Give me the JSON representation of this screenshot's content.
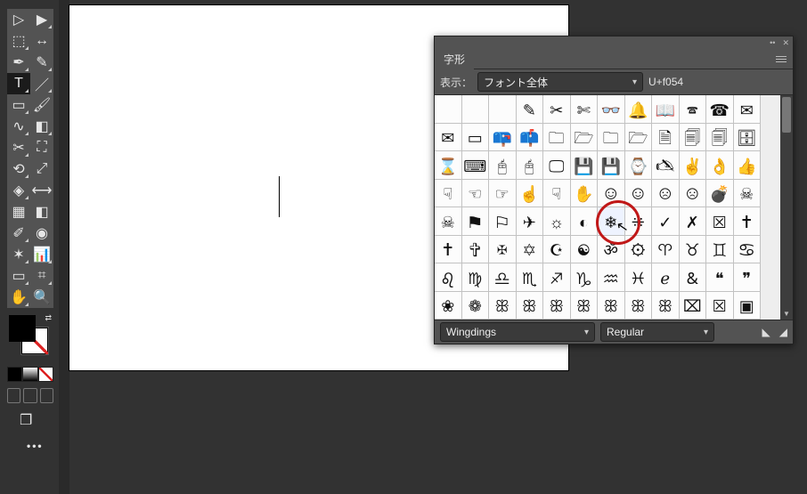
{
  "toolbox": {
    "tools": [
      {
        "name": "selection-tool",
        "glyph": "▷",
        "tri": false
      },
      {
        "name": "direct-selection-tool",
        "glyph": "▶",
        "tri": true
      },
      {
        "name": "page-tool",
        "glyph": "⬚",
        "tri": true
      },
      {
        "name": "gap-tool",
        "glyph": "↔",
        "tri": false
      },
      {
        "name": "pen-tool",
        "glyph": "✒",
        "tri": true
      },
      {
        "name": "pencil-tool",
        "glyph": "✎",
        "tri": true
      },
      {
        "name": "type-tool",
        "glyph": "T",
        "tri": true,
        "selected": true
      },
      {
        "name": "line-tool",
        "glyph": "／",
        "tri": true
      },
      {
        "name": "rectangle-frame-tool",
        "glyph": "▭",
        "tri": true
      },
      {
        "name": "brush-tool",
        "glyph": "🖌",
        "tri": false
      },
      {
        "name": "curve-tool",
        "glyph": "∿",
        "tri": true
      },
      {
        "name": "eraser-tool",
        "glyph": "◧",
        "tri": true
      },
      {
        "name": "scissors-tool",
        "glyph": "✂",
        "tri": true
      },
      {
        "name": "crop-tool",
        "glyph": "⛶",
        "tri": false
      },
      {
        "name": "transform-tool",
        "glyph": "⟲",
        "tri": true
      },
      {
        "name": "transform2-tool",
        "glyph": "⤢",
        "tri": false
      },
      {
        "name": "distort-tool",
        "glyph": "◈",
        "tri": true
      },
      {
        "name": "free-transform-tool",
        "glyph": "⟷",
        "tri": false
      },
      {
        "name": "mesh-tool",
        "glyph": "▦",
        "tri": false
      },
      {
        "name": "gradient-tool",
        "glyph": "◧",
        "tri": false
      },
      {
        "name": "eyedropper-tool",
        "glyph": "✐",
        "tri": true
      },
      {
        "name": "blend-tool",
        "glyph": "◉",
        "tri": false
      },
      {
        "name": "symbol-tool",
        "glyph": "✶",
        "tri": true
      },
      {
        "name": "graph-tool",
        "glyph": "📊",
        "tri": true
      },
      {
        "name": "artboard-tool",
        "glyph": "▭",
        "tri": true
      },
      {
        "name": "slice-tool",
        "glyph": "⌗",
        "tri": true
      },
      {
        "name": "hand-tool",
        "glyph": "✋",
        "tri": true
      },
      {
        "name": "zoom-tool",
        "glyph": "🔍",
        "tri": false
      }
    ]
  },
  "panel": {
    "title": "字形",
    "show_label": "表示：",
    "show_value": "フォント全体",
    "codepoint": "U+f054",
    "font": "Wingdings",
    "style": "Regular",
    "highlight_index": 54,
    "glyph_rows": [
      [
        "",
        "",
        "",
        "✎",
        "✂",
        "✄",
        "👓",
        "🔔",
        "📖",
        "🕿",
        "☎",
        "✉"
      ],
      [
        "✉",
        "▭",
        "📪",
        "📫",
        "🗀",
        "🗁",
        "🗀",
        "🗁",
        "🗎",
        "🗐",
        "🗐",
        "🗄"
      ],
      [
        "⌛",
        "⌨",
        "🖰",
        "🖰",
        "🖵",
        "💾",
        "💾",
        "⌚",
        "🖎",
        "✌",
        "👌",
        "👍"
      ],
      [
        "☟",
        "☜",
        "☞",
        "☝",
        "☟",
        "✋",
        "☺",
        "☺",
        "☹",
        "☹",
        "💣",
        "☠"
      ],
      [
        "☠",
        "⚑",
        "⚐",
        "✈",
        "☼",
        "◐",
        "❄",
        "⁜",
        "✓",
        "✗",
        "☒",
        "✝"
      ],
      [
        "✝",
        "✞",
        "✠",
        "✡",
        "☪",
        "☯",
        "ॐ",
        "⚙",
        "♈",
        "♉",
        "♊",
        "♋"
      ],
      [
        "♌",
        "♍",
        "♎",
        "♏",
        "♐",
        "♑",
        "♒",
        "♓",
        "ℯ",
        "&",
        "❝",
        "❞"
      ],
      [
        "❀",
        "❁",
        "ꕥ",
        "ꕥ",
        "ꕥ",
        "ꕥ",
        "ꕥ",
        "ꕥ",
        "ꕥ",
        "⌧",
        "☒",
        "▣"
      ]
    ]
  }
}
